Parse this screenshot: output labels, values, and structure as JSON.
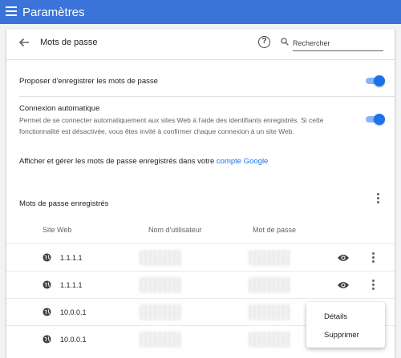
{
  "app_bar": {
    "title": "Paramètres"
  },
  "header": {
    "title": "Mots de passe",
    "search_placeholder": "Rechercher"
  },
  "settings": {
    "offer_save": {
      "label": "Proposer d'enregistrer les mots de passe",
      "enabled": true
    },
    "auto_signin": {
      "label": "Connexion automatique",
      "description": "Permet de se connecter automatiquement aux sites Web à l'aide des identifiants enregistrés. Si cette fonctionnalité est désactivée, vous êtes invité à confirmer chaque connexion à un site Web.",
      "enabled": true
    },
    "manage": {
      "text": "Afficher et gérer les mots de passe enregistrés dans votre ",
      "link": "compte Google"
    }
  },
  "saved": {
    "title": "Mots de passe enregistrés",
    "columns": {
      "site": "Site Web",
      "user": "Nom d'utilisateur",
      "password": "Mot de passe"
    },
    "rows": [
      {
        "site": "1.1.1.1"
      },
      {
        "site": "1.1.1.1"
      },
      {
        "site": "10.0.0.1"
      },
      {
        "site": "10.0.0.1"
      }
    ]
  },
  "context_menu": {
    "details": "Détails",
    "delete": "Supprimer"
  },
  "colors": {
    "app_bar": "#3b74d8",
    "accent": "#1a73e8",
    "toggle_track": "#8ab4f8"
  }
}
